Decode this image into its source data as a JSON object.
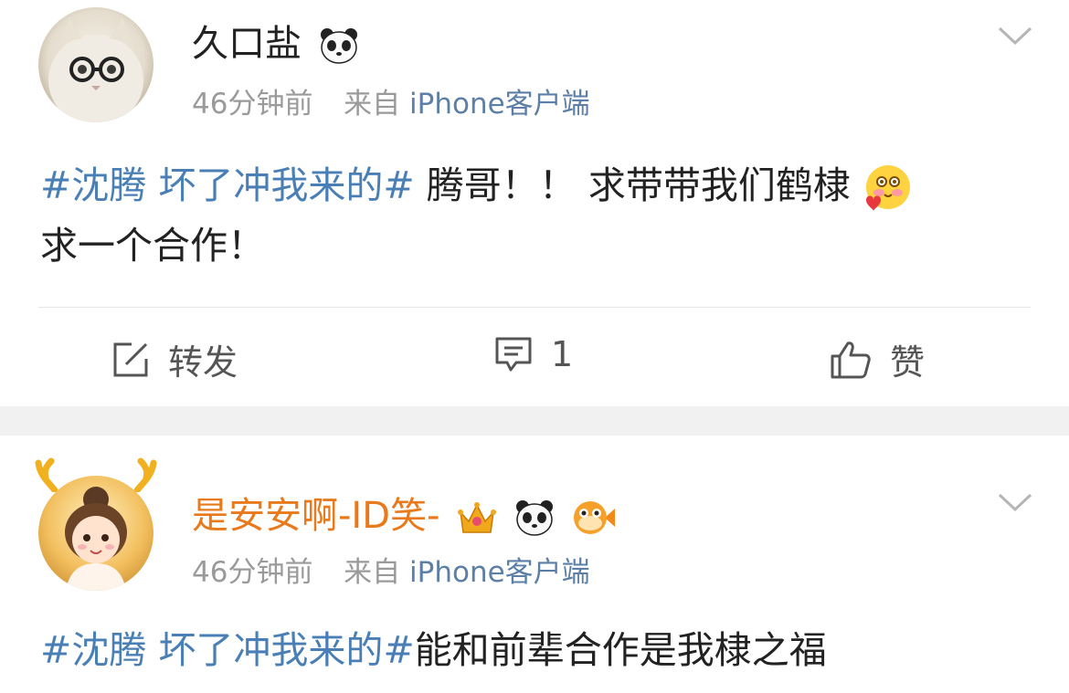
{
  "posts": [
    {
      "username": "久口盐",
      "time": "46分钟前",
      "source_prefix": "来自",
      "source": "iPhone客户端",
      "hashtag": "#沈腾 坏了冲我来的#",
      "content_line1": " 腾哥！！ 求带带我们鹤棣",
      "content_line2": "求一个合作！",
      "badges": [
        "panda-icon"
      ],
      "actions": {
        "repost": "转发",
        "comment": "1",
        "like": "赞"
      }
    },
    {
      "username": "是安安啊-ID笑-",
      "time": "46分钟前",
      "source_prefix": "来自",
      "source": "iPhone客户端",
      "hashtag": "#沈腾 坏了冲我来的#",
      "content_line1": "能和前辈合作是我棣之福",
      "badges": [
        "crown-icon",
        "panda-icon",
        "pufferfish-icon"
      ]
    }
  ],
  "colors": {
    "hashtag": "#4a7fb6",
    "username_vip": "#e87a1c",
    "meta_gray": "#9a9a9a",
    "source_blue": "#5b7fa6",
    "separator": "#f1f1f1"
  }
}
